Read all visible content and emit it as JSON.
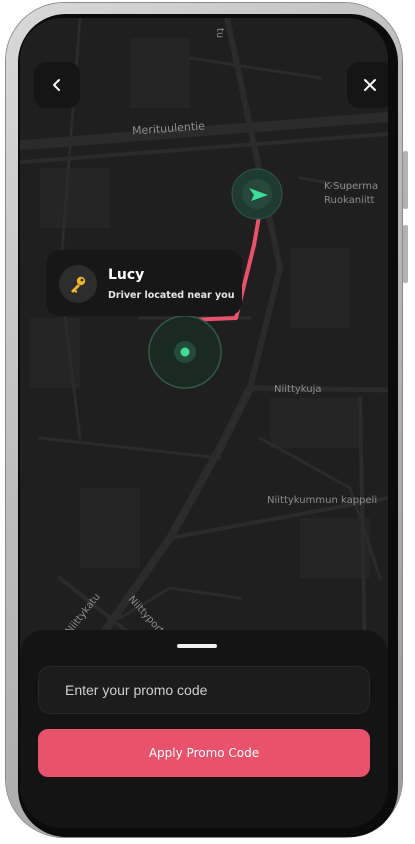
{
  "map": {
    "streets": [
      "Merituulentie",
      "Niittykuja",
      "Niittykummun kappeli",
      "Niittyportti",
      "Niittykatu",
      "K-Superma",
      "Ruokaniitt",
      "tu"
    ],
    "route_color": "#e8526a",
    "driver_marker_color": "#3ddc97"
  },
  "nav": {
    "back_icon": "chevron-left-icon",
    "close_icon": "close-icon"
  },
  "driver_card": {
    "name": "Lucy",
    "status": "Driver located near you",
    "avatar_icon": "key-icon"
  },
  "promo": {
    "placeholder": "Enter your promo code",
    "value": ""
  },
  "apply_button": {
    "label": "Apply Promo Code",
    "color": "#e8526a"
  }
}
